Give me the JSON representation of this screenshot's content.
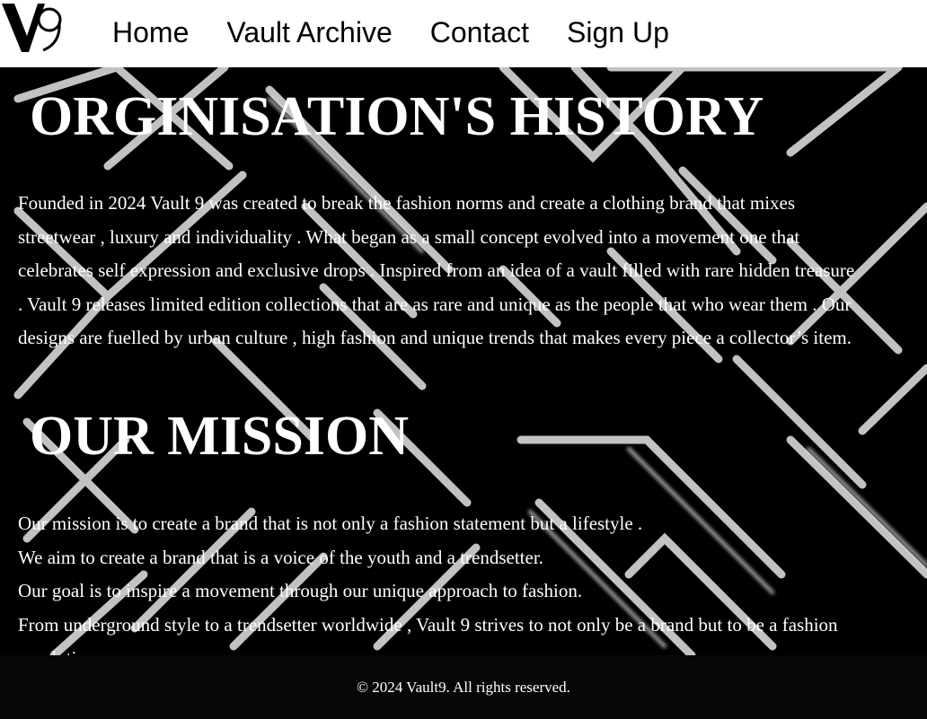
{
  "header": {
    "logo_text": "VAULT 9",
    "nav": [
      {
        "label": "Home"
      },
      {
        "label": "Vault Archive"
      },
      {
        "label": "Contact"
      },
      {
        "label": "Sign Up"
      }
    ]
  },
  "main": {
    "history": {
      "title": "ORGINISATION'S HISTORY",
      "body": "Founded in 2024 Vault 9 was created to break the fashion norms and create a clothing brand that mixes streetwear , luxury and individuality . What began as a small concept evolved into a movement one that celebrates self expression and exclusive drops . Inspired from an idea of a vault filled with rare hidden treasure . Vault 9 releases limited edition collections that are as rare and unique as the people that who wear them . Our designs are fuelled by urban culture , high fashion and unique trends that makes every piece a collector’s item."
    },
    "mission": {
      "title": "OUR MISSION",
      "lines": [
        "Our mission is to create a brand that is not only a fashion statement but a lifestyle .",
        "We aim to create a brand that is a voice of the youth and a trendsetter.",
        "Our goal is to inspire a movement through our unique approach to fashion.",
        "From underground style to a trendsetter worldwide , Vault 9 strives to not only be a brand but to be a fashion revolution."
      ]
    }
  },
  "footer": {
    "copyright": "© 2024 Vault9. All rights reserved."
  },
  "colors": {
    "header_bg": "#ffffff",
    "page_bg": "#000000",
    "footer_bg": "#070707",
    "text": "#ffffff"
  }
}
